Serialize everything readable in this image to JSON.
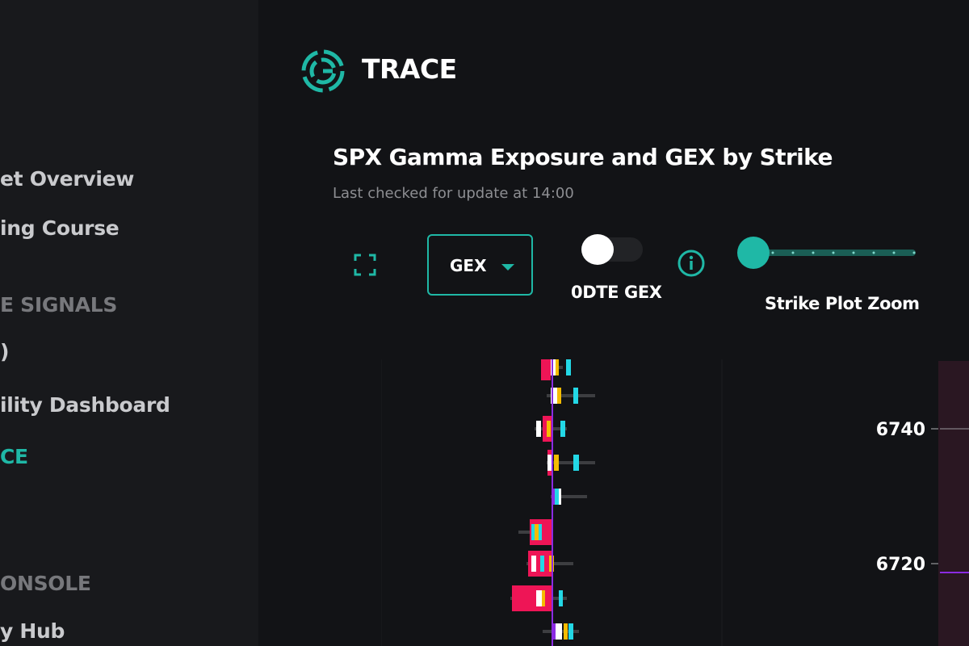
{
  "sidebar": {
    "items": [
      {
        "label": "et Overview",
        "active": false
      },
      {
        "label": "ing Course",
        "active": false
      },
      {
        "label": ")",
        "active": false
      },
      {
        "label": "ility Dashboard",
        "active": false
      },
      {
        "label": "CE",
        "active": true
      },
      {
        "label": "y Hub",
        "active": false
      }
    ],
    "sections": [
      {
        "label": "E SIGNALS"
      },
      {
        "label": "ONSOLE"
      }
    ]
  },
  "brand": {
    "name": "TRACE",
    "logo_icon": "trace-logo-icon",
    "accent_color": "#1fb8a6"
  },
  "page": {
    "title": "SPX Gamma Exposure and GEX by Strike",
    "last_checked": "Last checked for update at 14:00"
  },
  "controls": {
    "fullscreen_icon": "fullscreen-icon",
    "gex_select": {
      "value": "GEX",
      "caret_icon": "caret-down-icon"
    },
    "odte_toggle": {
      "label": "0DTE GEX",
      "on": false
    },
    "info_icon": "info-icon",
    "zoom_slider": {
      "label": "Strike Plot Zoom",
      "value": 0
    }
  },
  "chart_data": {
    "type": "bar",
    "ylabel": "",
    "y_ticks": [
      6740,
      6720
    ],
    "colors": {
      "negative": "#ee1556",
      "white": "#ffffff",
      "yellow": "#f5bc00",
      "cyan": "#23d8e6",
      "purple": "#8b2be2",
      "grey": "#3d3e41",
      "spot_line": "#c7a1d8"
    }
  }
}
